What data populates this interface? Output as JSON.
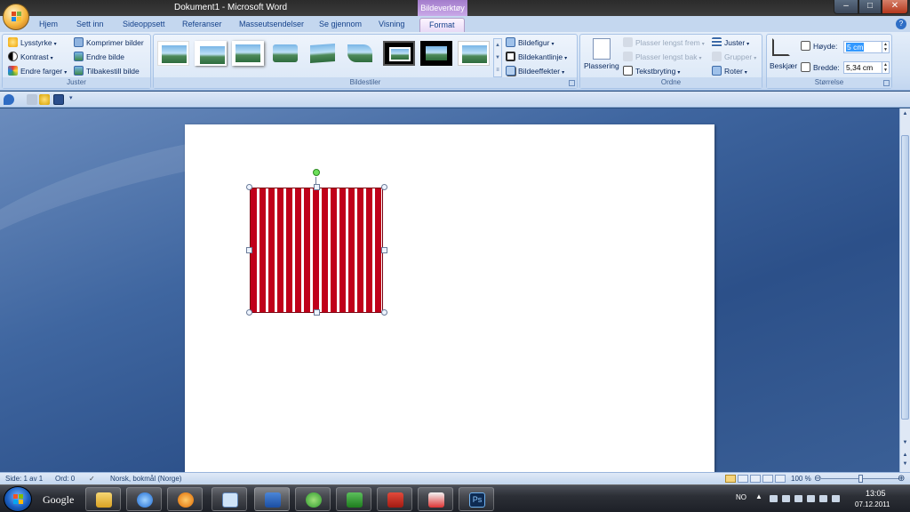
{
  "window": {
    "title": "Dokument1 - Microsoft Word",
    "context_group": "Bildeverktøy",
    "min": "–",
    "max": "□",
    "close": "✕"
  },
  "tabs": [
    "Hjem",
    "Sett inn",
    "Sideoppsett",
    "Referanser",
    "Masseutsendelser",
    "Se gjennom",
    "Visning",
    "Format"
  ],
  "active_tab": "Format",
  "groups": {
    "juster": {
      "label": "Juster",
      "items": [
        "Lysstyrke",
        "Kontrast",
        "Endre farger",
        "Komprimer bilder",
        "Endre bilde",
        "Tilbakestill bilde"
      ]
    },
    "bildestiler": {
      "label": "Bildestiler",
      "items": [
        "Bildefigur",
        "Bildekantlinje",
        "Bildeeffekter"
      ]
    },
    "ordne": {
      "label": "Ordne",
      "placement": "Plassering",
      "items": [
        "Plasser lengst frem",
        "Plasser lengst bak",
        "Tekstbryting",
        "Juster",
        "Grupper",
        "Roter"
      ]
    },
    "storrelse": {
      "label": "Størrelse",
      "crop": "Beskjær",
      "height_label": "Høyde:",
      "height_value": "5 cm",
      "width_label": "Bredde:",
      "width_value": "5,34 cm"
    }
  },
  "statusbar": {
    "page": "Side: 1 av 1",
    "words": "Ord: 0",
    "language": "Norsk, bokmål (Norge)",
    "zoom": "100 %"
  },
  "taskbar": {
    "google_label": "Google",
    "lang": "NO",
    "time": "13:05",
    "date": "07.12.2011"
  },
  "icons": {
    "start": "windows-start-icon",
    "office": "office-button-icon"
  }
}
